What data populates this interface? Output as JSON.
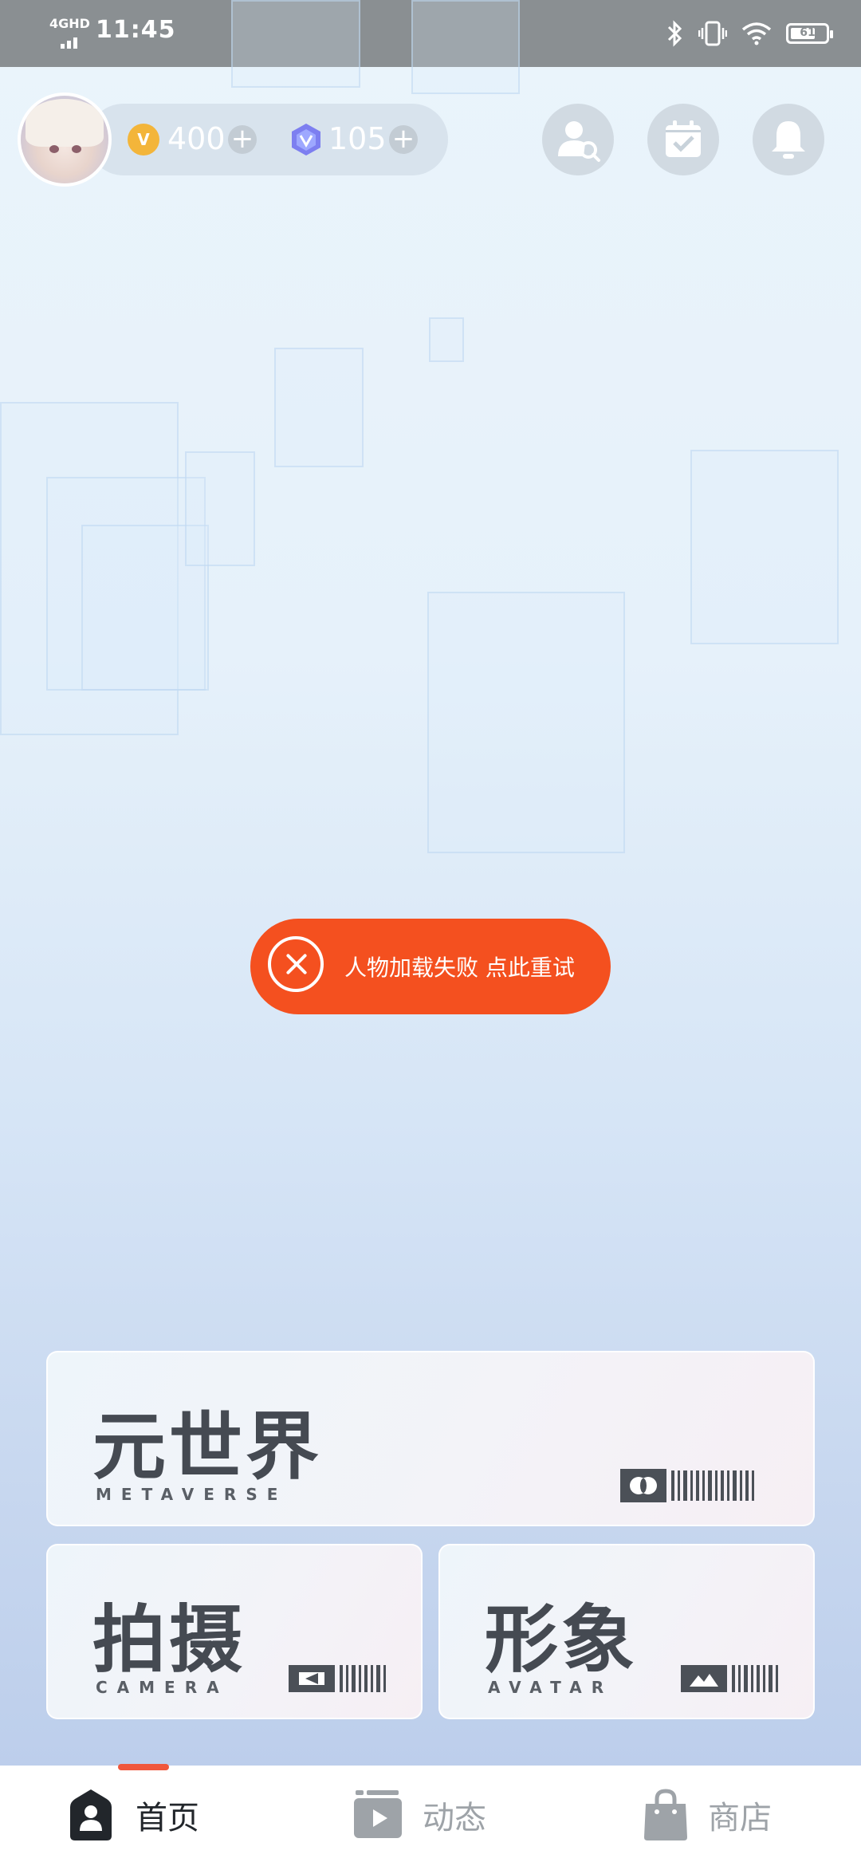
{
  "status_bar": {
    "network": "4GHD",
    "time": "11:45",
    "battery": "61"
  },
  "header": {
    "coins": "400",
    "gems": "105",
    "coin_symbol": "V"
  },
  "toast": {
    "message": "人物加载失败 点此重试"
  },
  "cards": {
    "metaverse": {
      "title": "元世界",
      "subtitle": "METAVERSE"
    },
    "camera": {
      "title": "拍摄",
      "subtitle": "CAMERA"
    },
    "avatar": {
      "title": "形象",
      "subtitle": "AVATAR"
    }
  },
  "nav": {
    "items": [
      {
        "label": "首页",
        "icon": "home-icon",
        "active": true
      },
      {
        "label": "动态",
        "icon": "video-feed-icon",
        "active": false
      },
      {
        "label": "商店",
        "icon": "shopping-bag-icon",
        "active": false
      }
    ]
  },
  "colors": {
    "accent": "#f4501f",
    "nav_indicator": "#f0573c",
    "card_text": "#454a52"
  }
}
